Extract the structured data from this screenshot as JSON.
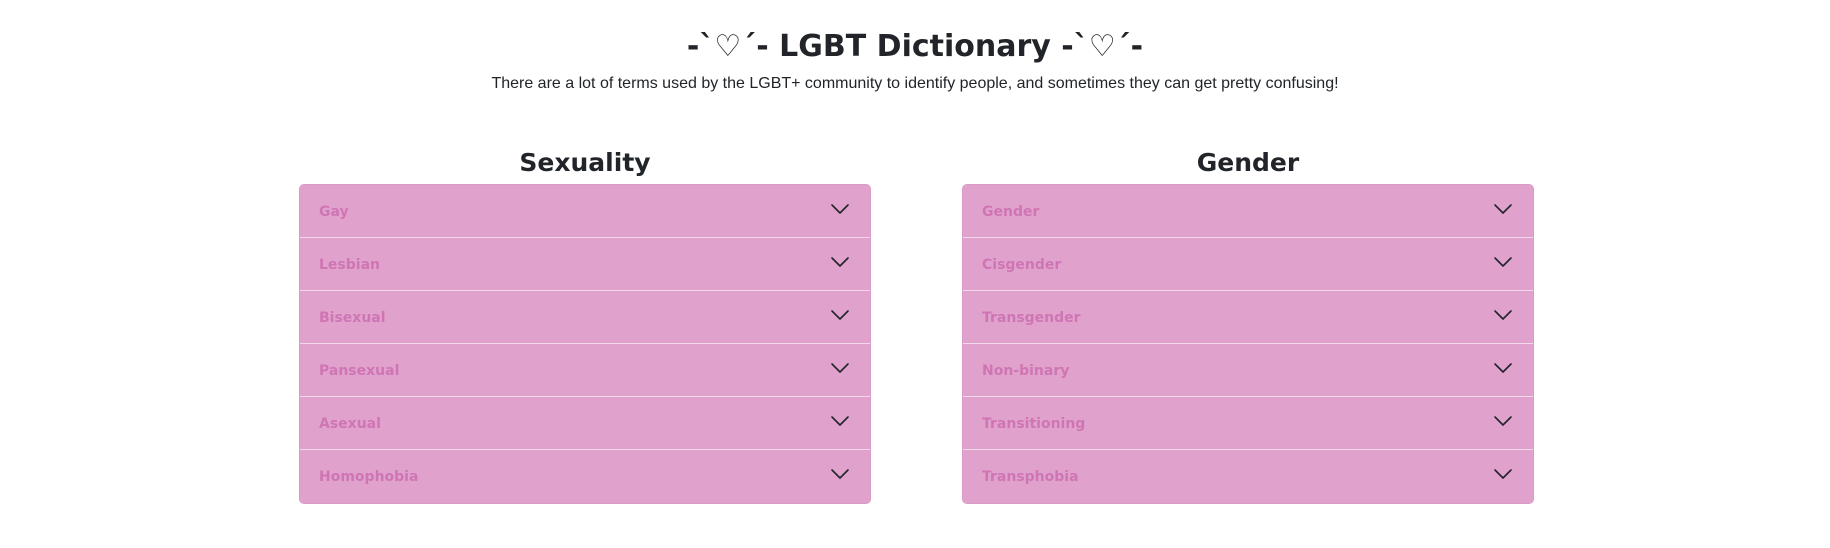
{
  "header": {
    "title": "-ˋ♡ˊ- LGBT Dictionary -ˋ♡ˊ-",
    "subtitle": "There are a lot of terms used by the LGBT+ community to identify people, and sometimes they can get pretty confusing!"
  },
  "sexuality": {
    "title": "Sexuality",
    "items": [
      {
        "label": "Gay",
        "icon": "chevron-down-icon"
      },
      {
        "label": "Lesbian",
        "icon": "chevron-down-icon"
      },
      {
        "label": "Bisexual",
        "icon": "chevron-down-icon"
      },
      {
        "label": "Pansexual",
        "icon": "chevron-down-icon"
      },
      {
        "label": "Asexual",
        "icon": "chevron-down-icon"
      },
      {
        "label": "Homophobia",
        "icon": "chevron-down-icon"
      }
    ]
  },
  "gender": {
    "title": "Gender",
    "items": [
      {
        "label": "Gender",
        "icon": "chevron-down-icon"
      },
      {
        "label": "Cisgender",
        "icon": "chevron-down-icon"
      },
      {
        "label": "Transgender",
        "icon": "chevron-down-icon"
      },
      {
        "label": "Non-binary",
        "icon": "chevron-down-icon"
      },
      {
        "label": "Transitioning",
        "icon": "chevron-down-icon"
      },
      {
        "label": "Transphobia",
        "icon": "chevron-down-icon"
      }
    ]
  },
  "colors": {
    "accordion_background": "#e0a2cd",
    "item_text": "#cf75b3",
    "divider": "#f3d7ea",
    "heading_text": "#212529"
  }
}
